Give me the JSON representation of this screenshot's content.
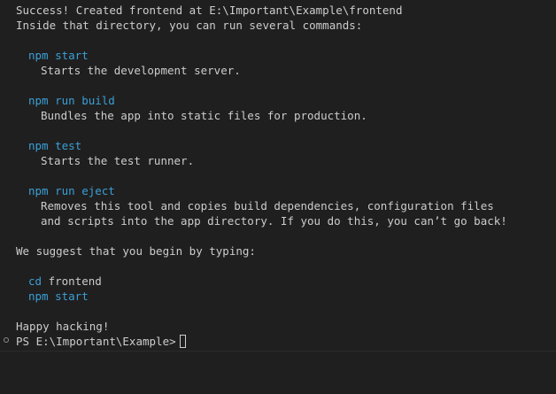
{
  "terminal": {
    "success": "Success! Created frontend at E:\\Important\\Example\\frontend",
    "inside": "Inside that directory, you can run several commands:",
    "commands": [
      {
        "cmd": "npm start",
        "desc": [
          "Starts the development server."
        ]
      },
      {
        "cmd": "npm run build",
        "desc": [
          "Bundles the app into static files for production."
        ]
      },
      {
        "cmd": "npm test",
        "desc": [
          "Starts the test runner."
        ]
      },
      {
        "cmd": "npm run eject",
        "desc": [
          "Removes this tool and copies build dependencies, configuration files",
          "and scripts into the app directory. If you do this, you can’t go back!"
        ]
      }
    ],
    "suggest": "We suggest that you begin by typing:",
    "suggested": [
      "cd",
      "frontend",
      "npm start"
    ],
    "happy": "Happy hacking!",
    "prompt": "PS E:\\Important\\Example>"
  }
}
